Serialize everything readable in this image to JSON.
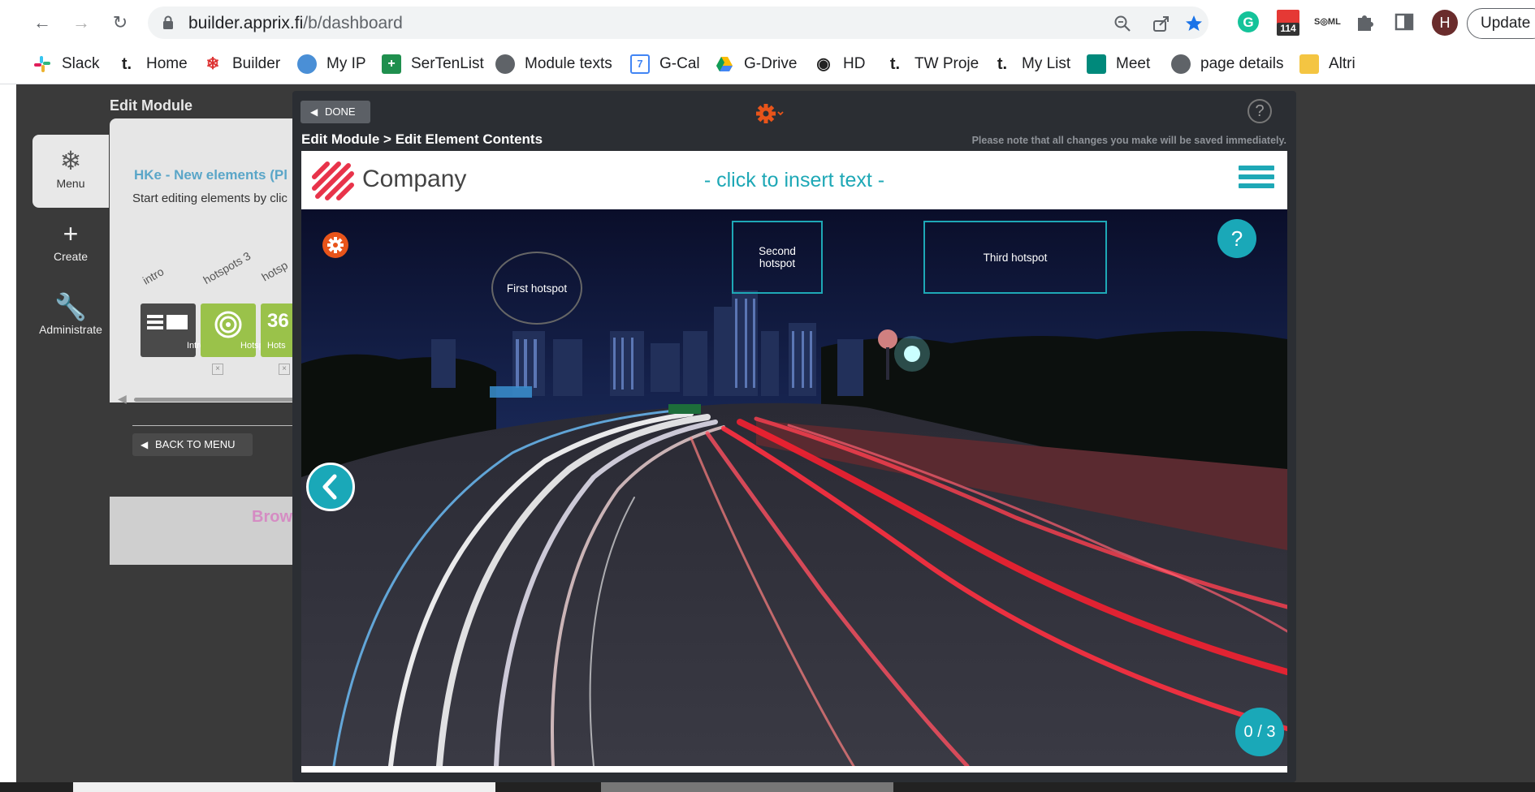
{
  "browser": {
    "url_host": "builder.apprix.fi",
    "url_path": "/b/dashboard",
    "extension_badge": "114",
    "avatar_letter": "H",
    "update_label": "Update"
  },
  "bookmarks": [
    {
      "label": "Slack",
      "icon": "slack-icon"
    },
    {
      "label": "Home",
      "icon": "t-icon"
    },
    {
      "label": "Builder",
      "icon": "snowflake-icon"
    },
    {
      "label": "My IP",
      "icon": "globe-icon"
    },
    {
      "label": "SerTenList",
      "icon": "plus-icon"
    },
    {
      "label": "Module texts",
      "icon": "globe-icon"
    },
    {
      "label": "G-Cal",
      "icon": "calendar-icon"
    },
    {
      "label": "G-Drive",
      "icon": "drive-icon"
    },
    {
      "label": "HD",
      "icon": "at-icon"
    },
    {
      "label": "TW Proje",
      "icon": "t-icon"
    },
    {
      "label": "My List",
      "icon": "t-icon"
    },
    {
      "label": "Meet",
      "icon": "meet-icon"
    },
    {
      "label": "page details",
      "icon": "globe-icon"
    },
    {
      "label": "Altri",
      "icon": "folder-icon"
    }
  ],
  "app": {
    "title": "Edit Module",
    "sidebar": [
      {
        "label": "Menu",
        "icon": "snowflake-icon"
      },
      {
        "label": "Create",
        "icon": "plus-icon"
      },
      {
        "label": "Administrate",
        "icon": "wrench-icon"
      }
    ],
    "module_title": "HKe - New elements (Pl",
    "module_sub": "Start editing elements by clic",
    "element_names": [
      "intro",
      "hotspots 3",
      "hotsp"
    ],
    "tiles": [
      {
        "label": "Intro"
      },
      {
        "label": "Hotspot"
      },
      {
        "label": "Hots",
        "glyph": "36"
      }
    ],
    "back_label": "BACK TO MENU",
    "browse_label": "Brows"
  },
  "modal": {
    "done_label": "DONE",
    "breadcrumb": "Edit Module > Edit Element Contents",
    "note": "Please note that all changes you make will be saved immediately.",
    "help_glyph": "?"
  },
  "preview": {
    "company": "Company",
    "insert_text": "- click to insert text -",
    "hotspots": [
      {
        "label": "First hotspot"
      },
      {
        "label": "Second hotspot"
      },
      {
        "label": "Third hotspot"
      }
    ],
    "help_glyph": "?",
    "counter": "0 / 3"
  },
  "colors": {
    "accent": "#1ea8b6",
    "orange": "#e8541a",
    "brand_red": "#e8334a"
  }
}
